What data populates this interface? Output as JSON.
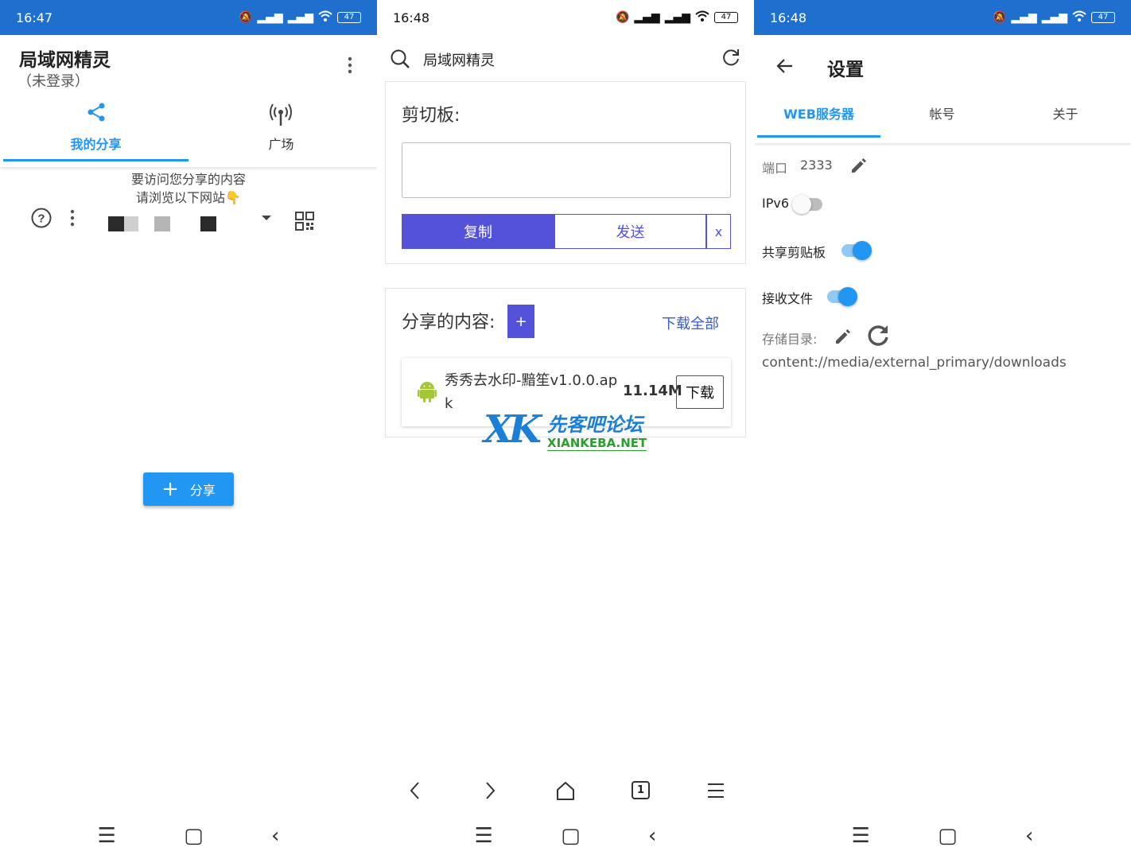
{
  "colors": {
    "primary_blue": "#1f6fce",
    "accent_blue": "#2196f3",
    "purple": "#5352d9",
    "android_green": "#a4c639"
  },
  "panel1": {
    "status": {
      "time": "16:47",
      "battery": "47"
    },
    "header": {
      "title": "局域网精灵",
      "subtitle": "（未登录）"
    },
    "tabs": [
      {
        "label": "我的分享",
        "icon": "share-icon"
      },
      {
        "label": "广场",
        "icon": "broadcast-icon"
      }
    ],
    "hint": {
      "line1": "要访问您分享的内容",
      "line2": "请浏览以下网站👇"
    },
    "share_button": {
      "label": "分享"
    }
  },
  "panel2": {
    "status": {
      "time": "16:48",
      "battery": "47"
    },
    "search": {
      "query": "局域网精灵"
    },
    "clipboard": {
      "title": "剪切板:",
      "value": "",
      "copy_label": "复制",
      "send_label": "发送",
      "clear_label": "x"
    },
    "shared": {
      "title": "分享的内容:",
      "add_label": "+",
      "download_all_label": "下载全部"
    },
    "files": [
      {
        "name": "秀秀去水印-黯笙v1.0.0.apk",
        "size": "11.14M",
        "download_label": "下载"
      }
    ],
    "watermark": {
      "logo": "XK",
      "cn": "先客吧论坛",
      "en": "XIANKEBA.NET"
    },
    "browser_nav": {
      "tab_count": "1"
    }
  },
  "panel3": {
    "status": {
      "time": "16:48",
      "battery": "47"
    },
    "title": "设置",
    "tabs": [
      "WEB服务器",
      "帐号",
      "关于"
    ],
    "port": {
      "label": "端口",
      "value": "2333"
    },
    "ipv6": {
      "label": "IPv6",
      "on": false
    },
    "share_clipboard": {
      "label": "共享剪贴板",
      "on": true
    },
    "receive_files": {
      "label": "接收文件",
      "on": true
    },
    "storage": {
      "label": "存储目录:",
      "path": "content://media/external_primary/downloads"
    }
  }
}
